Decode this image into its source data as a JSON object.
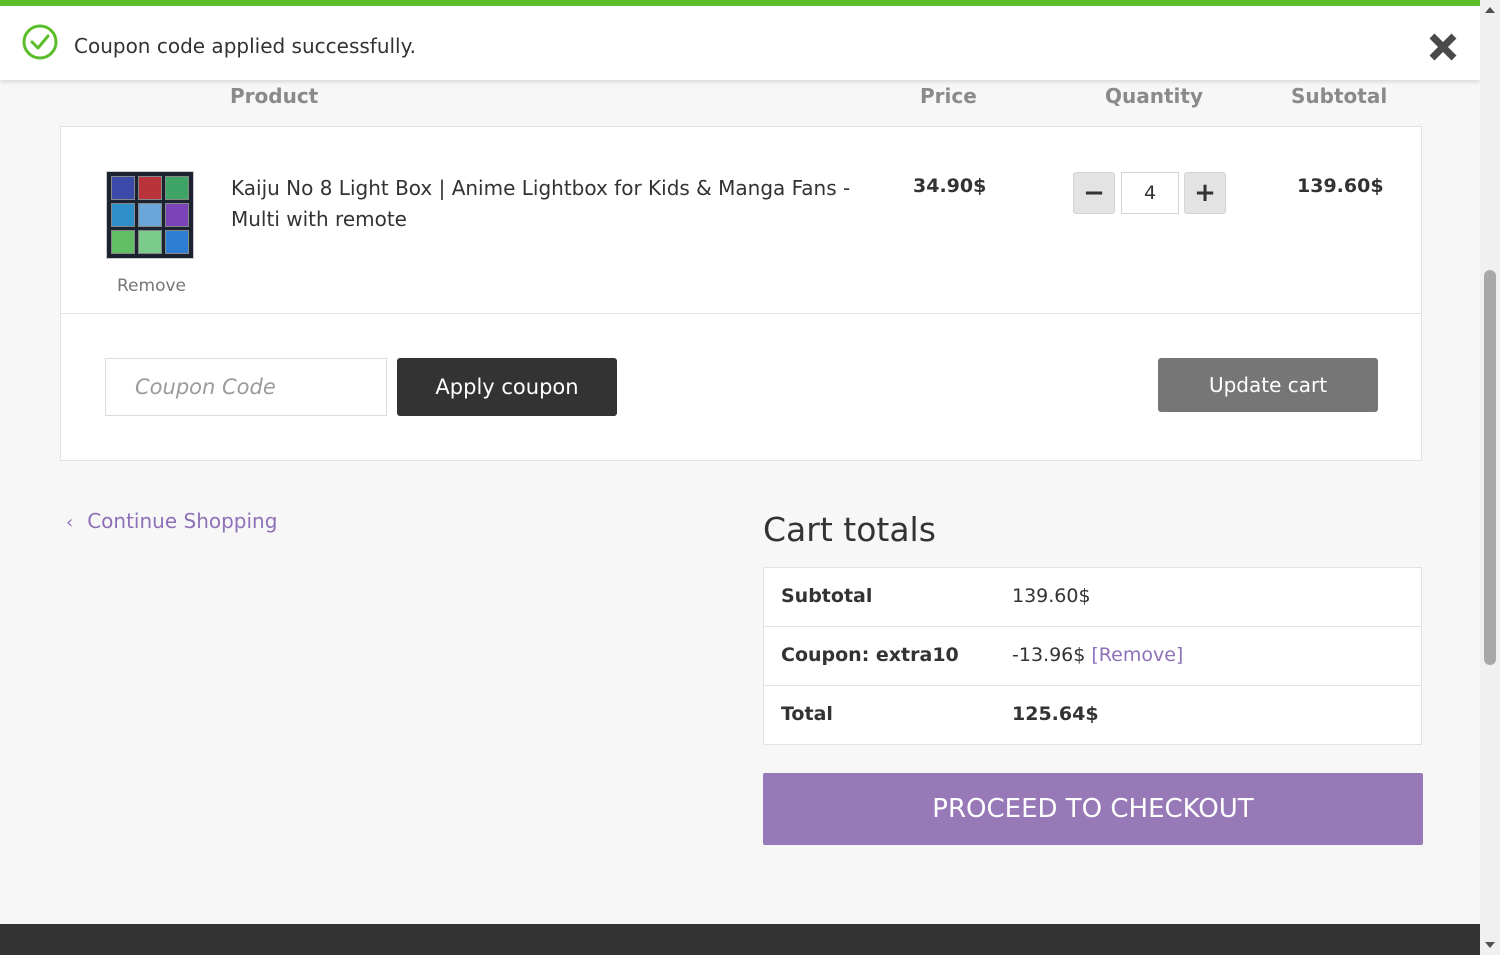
{
  "notice": {
    "message": "Coupon code applied successfully.",
    "icon": "check-circle-icon",
    "close_icon": "close-icon",
    "accent_color": "#5cbd2b"
  },
  "table_header": {
    "product": "Product",
    "price": "Price",
    "quantity": "Quantity",
    "subtotal": "Subtotal"
  },
  "cart_item": {
    "remove_label": "Remove",
    "name": "Kaiju No 8 Light Box | Anime Lightbox for Kids & Manga Fans - Multi with remote",
    "price": "34.90$",
    "quantity": "4",
    "minus_label": "−",
    "plus_label": "+",
    "subtotal": "139.60$"
  },
  "coupon": {
    "placeholder": "Coupon Code",
    "apply_label": "Apply coupon"
  },
  "update_cart_label": "Update cart",
  "continue_shopping": {
    "chevron": "‹",
    "label": "Continue Shopping"
  },
  "cart_totals": {
    "title": "Cart totals",
    "subtotal_label": "Subtotal",
    "subtotal_value": "139.60$",
    "coupon_label": "Coupon: extra10",
    "coupon_value": "-13.96$",
    "coupon_remove": "[Remove]",
    "total_label": "Total",
    "total_value": "125.64$"
  },
  "checkout_label": "PROCEED TO CHECKOUT",
  "colors": {
    "link": "#8e70b8",
    "checkout": "#9879b8",
    "dark_button": "#333333",
    "update_button": "#767676"
  }
}
